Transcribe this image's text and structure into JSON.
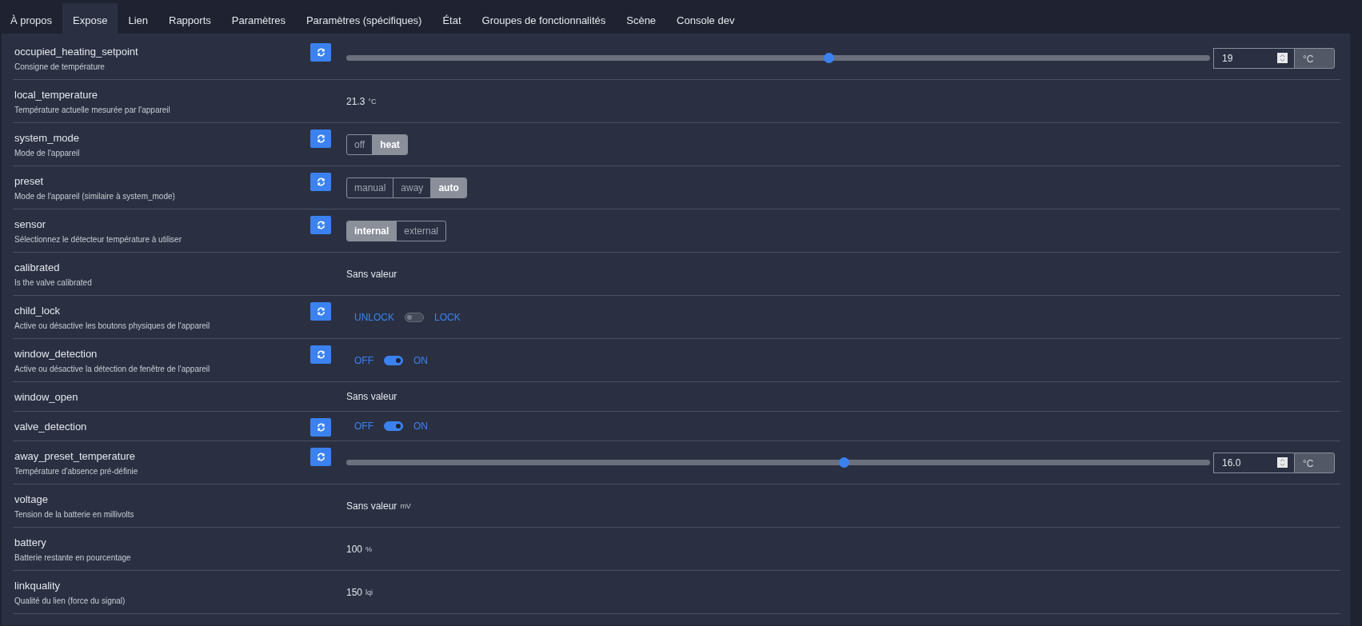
{
  "tabs": [
    {
      "label": "À propos",
      "selected": false
    },
    {
      "label": "Expose",
      "selected": true
    },
    {
      "label": "Lien",
      "selected": false
    },
    {
      "label": "Rapports",
      "selected": false
    },
    {
      "label": "Paramètres",
      "selected": false
    },
    {
      "label": "Paramètres (spécifiques)",
      "selected": false
    },
    {
      "label": "État",
      "selected": false
    },
    {
      "label": "Groupes de fonctionnalités",
      "selected": false
    },
    {
      "label": "Scène",
      "selected": false
    },
    {
      "label": "Console dev",
      "selected": false
    }
  ],
  "rows": [
    {
      "name": "occupied_heating_setpoint",
      "description": "Consigne de température",
      "refresh": true,
      "kind": "slider",
      "level": 0.558,
      "value": "19",
      "unit": "°C"
    },
    {
      "name": "local_temperature",
      "description": "Température actuelle mesurée par l'appareil",
      "refresh": false,
      "kind": "text",
      "value": "21.3",
      "unit": "°C"
    },
    {
      "name": "system_mode",
      "description": "Mode de l'appareil",
      "refresh": true,
      "kind": "enum",
      "options": [
        {
          "label": "off",
          "selected": false
        },
        {
          "label": "heat",
          "selected": true
        }
      ]
    },
    {
      "name": "preset",
      "description": "Mode de l'appareil (similaire à system_mode)",
      "refresh": true,
      "kind": "enum",
      "options": [
        {
          "label": "manual",
          "selected": false
        },
        {
          "label": "away",
          "selected": false
        },
        {
          "label": "auto",
          "selected": true
        }
      ]
    },
    {
      "name": "sensor",
      "description": "Sélectionnez le détecteur température à utiliser",
      "refresh": true,
      "kind": "enum",
      "options": [
        {
          "label": "internal",
          "selected": true
        },
        {
          "label": "external",
          "selected": false
        }
      ]
    },
    {
      "name": "calibrated",
      "description": "Is the valve calibrated",
      "refresh": false,
      "kind": "text",
      "value": "Sans valeur"
    },
    {
      "name": "child_lock",
      "description": "Active ou désactive les boutons physiques de l'appareil",
      "refresh": true,
      "kind": "toggle",
      "off_label": "UNLOCK",
      "on_label": "LOCK",
      "on": false
    },
    {
      "name": "window_detection",
      "description": "Active ou désactive la détection de fenêtre de l'appareil",
      "refresh": true,
      "kind": "toggle",
      "off_label": "OFF",
      "on_label": "ON",
      "on": true
    },
    {
      "name": "window_open",
      "refresh": false,
      "kind": "text",
      "value": "Sans valeur"
    },
    {
      "name": "valve_detection",
      "refresh": true,
      "kind": "toggle",
      "off_label": "OFF",
      "on_label": "ON",
      "on": true
    },
    {
      "name": "away_preset_temperature",
      "description": "Température d'absence pré-définie",
      "refresh": true,
      "kind": "slider",
      "level": 0.576,
      "value": "16.0",
      "unit": "°C"
    },
    {
      "name": "voltage",
      "description": "Tension de la batterie en millivolts",
      "refresh": false,
      "kind": "text",
      "value": "Sans valeur",
      "unit": "mV"
    },
    {
      "name": "battery",
      "description": "Batterie restante en pourcentage",
      "refresh": false,
      "kind": "text",
      "value": "100",
      "unit": "%"
    },
    {
      "name": "linkquality",
      "description": "Qualité du lien (force du signal)",
      "refresh": false,
      "kind": "text",
      "value": "150",
      "unit": "lqi"
    }
  ]
}
